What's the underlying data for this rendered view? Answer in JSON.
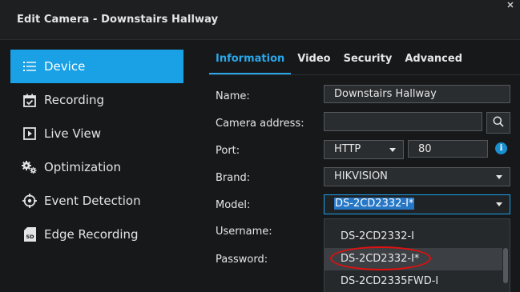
{
  "window": {
    "title": "Edit Camera - Downstairs Hallway"
  },
  "sidebar": {
    "items": [
      {
        "label": "Device",
        "icon": "list-icon",
        "active": true
      },
      {
        "label": "Recording",
        "icon": "calendar-check-icon"
      },
      {
        "label": "Live View",
        "icon": "play-icon"
      },
      {
        "label": "Optimization",
        "icon": "gears-icon"
      },
      {
        "label": "Event Detection",
        "icon": "crosshair-icon"
      },
      {
        "label": "Edge Recording",
        "icon": "sd-card-icon"
      }
    ]
  },
  "tabs": [
    {
      "label": "Information",
      "active": true
    },
    {
      "label": "Video"
    },
    {
      "label": "Security"
    },
    {
      "label": "Advanced"
    }
  ],
  "form": {
    "name_label": "Name:",
    "name_value": "Downstairs Hallway",
    "address_label": "Camera address:",
    "address_value": "",
    "port_label": "Port:",
    "port_protocol": "HTTP",
    "port_value": "80",
    "brand_label": "Brand:",
    "brand_value": "HIKVISION",
    "model_label": "Model:",
    "model_value": "DS-2CD2332-I*",
    "username_label": "Username:",
    "password_label": "Password:"
  },
  "dropdown": {
    "options": [
      "DS-2CD2332-I",
      "DS-2CD2332-I*",
      "DS-2CD2335FWD-I"
    ],
    "highlighted_index": 1
  },
  "colors": {
    "accent": "#1aa0e4",
    "annotation": "#e01010"
  }
}
